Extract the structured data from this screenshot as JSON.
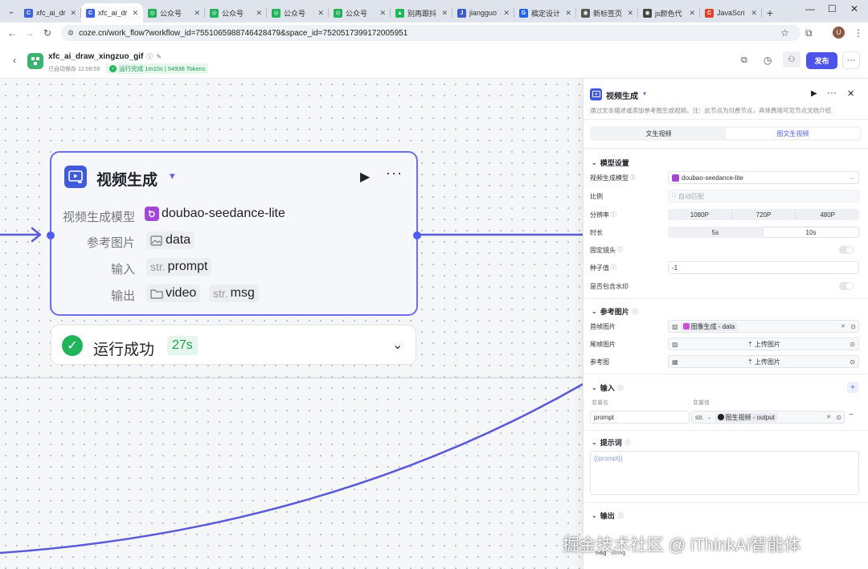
{
  "browser": {
    "tabs": [
      {
        "title": "xfc_ai_dr",
        "fav": "#3e63dd",
        "glyph": "C"
      },
      {
        "title": "xfc_ai_dr",
        "fav": "#3e63dd",
        "glyph": "C",
        "active": true
      },
      {
        "title": "公众号",
        "fav": "#22b05b",
        "glyph": "◎"
      },
      {
        "title": "公众号",
        "fav": "#22b05b",
        "glyph": "◎"
      },
      {
        "title": "公众号",
        "fav": "#22b05b",
        "glyph": "◎"
      },
      {
        "title": "公众号",
        "fav": "#22b05b",
        "glyph": "◎"
      },
      {
        "title": "别再跟抖",
        "fav": "#19b955",
        "glyph": "▲"
      },
      {
        "title": "jiangguo",
        "fav": "#3a5ccc",
        "glyph": "J"
      },
      {
        "title": "稿定设计",
        "fav": "#2563eb",
        "glyph": "G"
      },
      {
        "title": "新标签页",
        "fav": "#555555",
        "glyph": "◉"
      },
      {
        "title": "js颜色代",
        "fav": "#444444",
        "glyph": "◉"
      },
      {
        "title": "JavaScri",
        "fav": "#e0452b",
        "glyph": "C"
      }
    ],
    "url": "coze.cn/work_flow?workflow_id=7551065988746428479&space_id=7520517399172005951",
    "profile_initial": "U"
  },
  "appbar": {
    "workflow_name": "xfc_ai_draw_xingzuo_gif",
    "autosave": "已自动保存 12:08:59",
    "run_status": "运行完成 1m15s | 54938 Tokens",
    "publish_label": "发布"
  },
  "node": {
    "title": "视频生成",
    "rows": [
      {
        "label": "视频生成模型",
        "value": "doubao-seedance-lite"
      },
      {
        "label": "参考图片",
        "value": "data"
      },
      {
        "label": "输入",
        "prefix": "str.",
        "value": "prompt"
      },
      {
        "label": "输出",
        "value1": "video",
        "prefix2": "str.",
        "value2": "msg"
      }
    ],
    "result_label": "运行成功",
    "result_time": "27s"
  },
  "panel": {
    "title": "视频生成",
    "description": "通过文本描述或添加参考图生成视频。注：此节点为付费节点，具体费用可见节点文档介绍",
    "tabs": [
      "文生视频",
      "图文生视频"
    ],
    "model_section": "模型设置",
    "model_label": "视频生成模型",
    "model_value": "doubao-seedance-lite",
    "ratio_label": "比例",
    "ratio_value": "自动匹配",
    "resolution_label": "分辨率",
    "resolutions": [
      "1080P",
      "720P",
      "480P"
    ],
    "duration_label": "时长",
    "durations": [
      "5s",
      "10s"
    ],
    "fixed_camera_label": "固定镜头",
    "seed_label": "种子值",
    "seed_value": "-1",
    "watermark_label": "是否包含水印",
    "ref_section": "参考图片",
    "first_frame_label": "首帧图片",
    "first_frame_value": "图像生成 - data",
    "last_frame_label": "尾帧图片",
    "upload_label": "上传图片",
    "ref_image_label": "参考图",
    "input_section": "输入",
    "var_name_header": "变量名",
    "var_value_header": "变量值",
    "input_name": "prompt",
    "input_type": "str.",
    "input_value": "图生视频 - output",
    "prompt_section": "提示词",
    "prompt_value": "{{prompt}}",
    "output_section": "输出",
    "output_name": "msg",
    "output_type": "String"
  },
  "watermark_text": "掘金技术社区 @ iThinkAi智能体",
  "colors": {
    "accent": "#4e5ef2",
    "edge": "#5b5bd6",
    "success": "#22b45a",
    "publish": "#4d53e8"
  }
}
